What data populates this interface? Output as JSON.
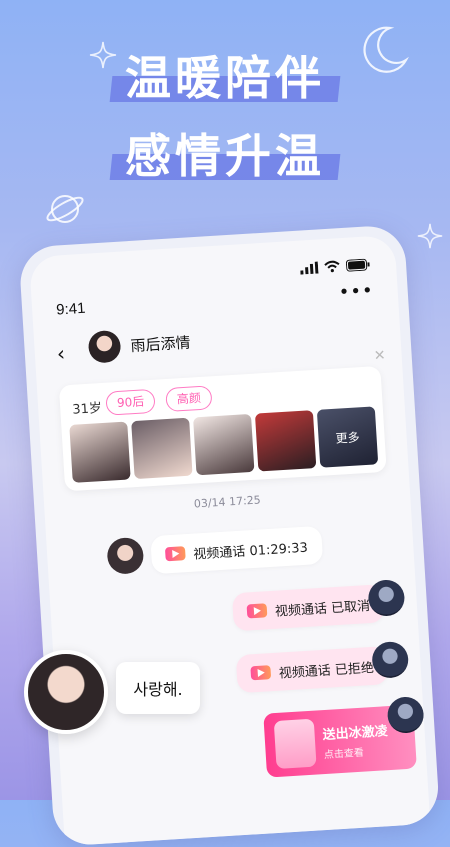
{
  "headline": {
    "line1": "温暖陪伴",
    "line2": "感情升温"
  },
  "status_bar": {
    "time": "9:41",
    "icons": [
      "signal-icon",
      "wifi-icon",
      "battery-icon"
    ]
  },
  "chat_header": {
    "back_icon": "chevron-left-icon",
    "contact_name": "雨后添情",
    "more_icon": "more-dots-icon"
  },
  "profile_card": {
    "age": "31岁",
    "tags": [
      "90后",
      "高颜"
    ],
    "more_label": "更多"
  },
  "timestamp": "03/14 17:25",
  "messages": [
    {
      "side": "left",
      "type": "video-call",
      "text": "视频通话 01:29:33"
    },
    {
      "side": "right",
      "type": "video-call",
      "text": "视频通话 已取消"
    },
    {
      "side": "right",
      "type": "video-call",
      "text": "视频通话 已拒绝"
    },
    {
      "side": "right",
      "type": "gift",
      "title": "送出冰激凌",
      "subtitle": "点击查看"
    }
  ],
  "floating_message": {
    "text": "사랑해."
  },
  "colors": {
    "accent_pink": "#ff5fb2",
    "headline_bar": "#6f7fe6"
  }
}
